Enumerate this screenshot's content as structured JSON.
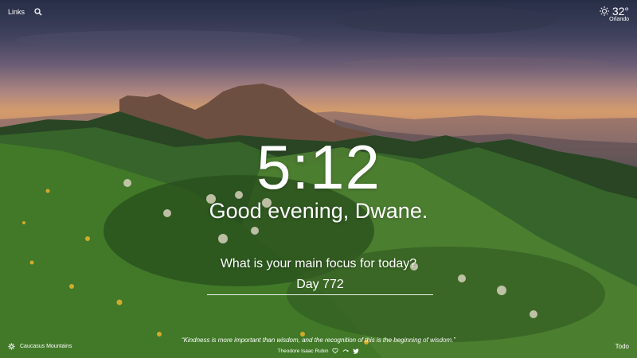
{
  "header": {
    "links_label": "Links",
    "search_icon": "search-icon"
  },
  "weather": {
    "icon": "sun-icon",
    "temperature": "32°",
    "location": "Orlando"
  },
  "clock": {
    "time": "5:12"
  },
  "greeting": {
    "text": "Good evening, Dwane."
  },
  "focus": {
    "question": "What is your main focus for today?",
    "value": "Day 772"
  },
  "footer": {
    "settings_icon": "gear-icon",
    "photo_location": "Caucasus Mountains",
    "quote": "“Kindness is more important than wisdom, and the recognition of this is the beginning of wisdom.”",
    "author": "Theodore Isaac Rubin",
    "todo_label": "Todo"
  }
}
